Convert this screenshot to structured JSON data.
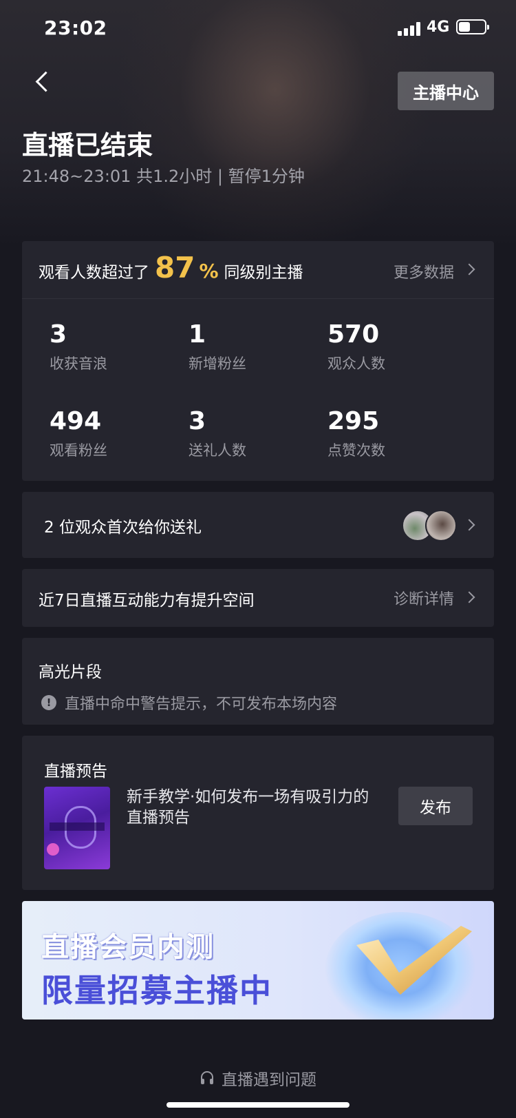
{
  "status_bar": {
    "time": "23:02",
    "network": "4G",
    "battery_level": 0.45
  },
  "header": {
    "anchor_center_label": "主播中心",
    "title": "直播已结束",
    "subtitle": "21:48~23:01 共1.2小时 | 暂停1分钟"
  },
  "stats": {
    "headline_prefix": "观看人数超过了",
    "headline_value": "87",
    "headline_unit": "%",
    "headline_suffix": "同级别主播",
    "more_label": "更多数据",
    "items": [
      {
        "value": "3",
        "label": "收获音浪"
      },
      {
        "value": "1",
        "label": "新增粉丝"
      },
      {
        "value": "570",
        "label": "观众人数"
      },
      {
        "value": "494",
        "label": "观看粉丝"
      },
      {
        "value": "3",
        "label": "送礼人数"
      },
      {
        "value": "295",
        "label": "点赞次数"
      }
    ]
  },
  "gift": {
    "text": "2 位观众首次给你送礼"
  },
  "interaction": {
    "text": "近7日直播互动能力有提升空间",
    "action_label": "诊断详情"
  },
  "highlight": {
    "title": "高光片段",
    "warning": "直播中命中警告提示，不可发布本场内容"
  },
  "preview": {
    "title": "直播预告",
    "description": "新手教学·如何发布一场有吸引力的直播预告",
    "publish_label": "发布"
  },
  "banner": {
    "line1": "直播会员内测",
    "line2": "限量招募主播中"
  },
  "help": {
    "label": "直播遇到问题"
  },
  "colors": {
    "accent": "#f3c24b",
    "card_bg": "#25252e",
    "page_bg": "#181820",
    "banner_text": "#4a4fd8"
  }
}
